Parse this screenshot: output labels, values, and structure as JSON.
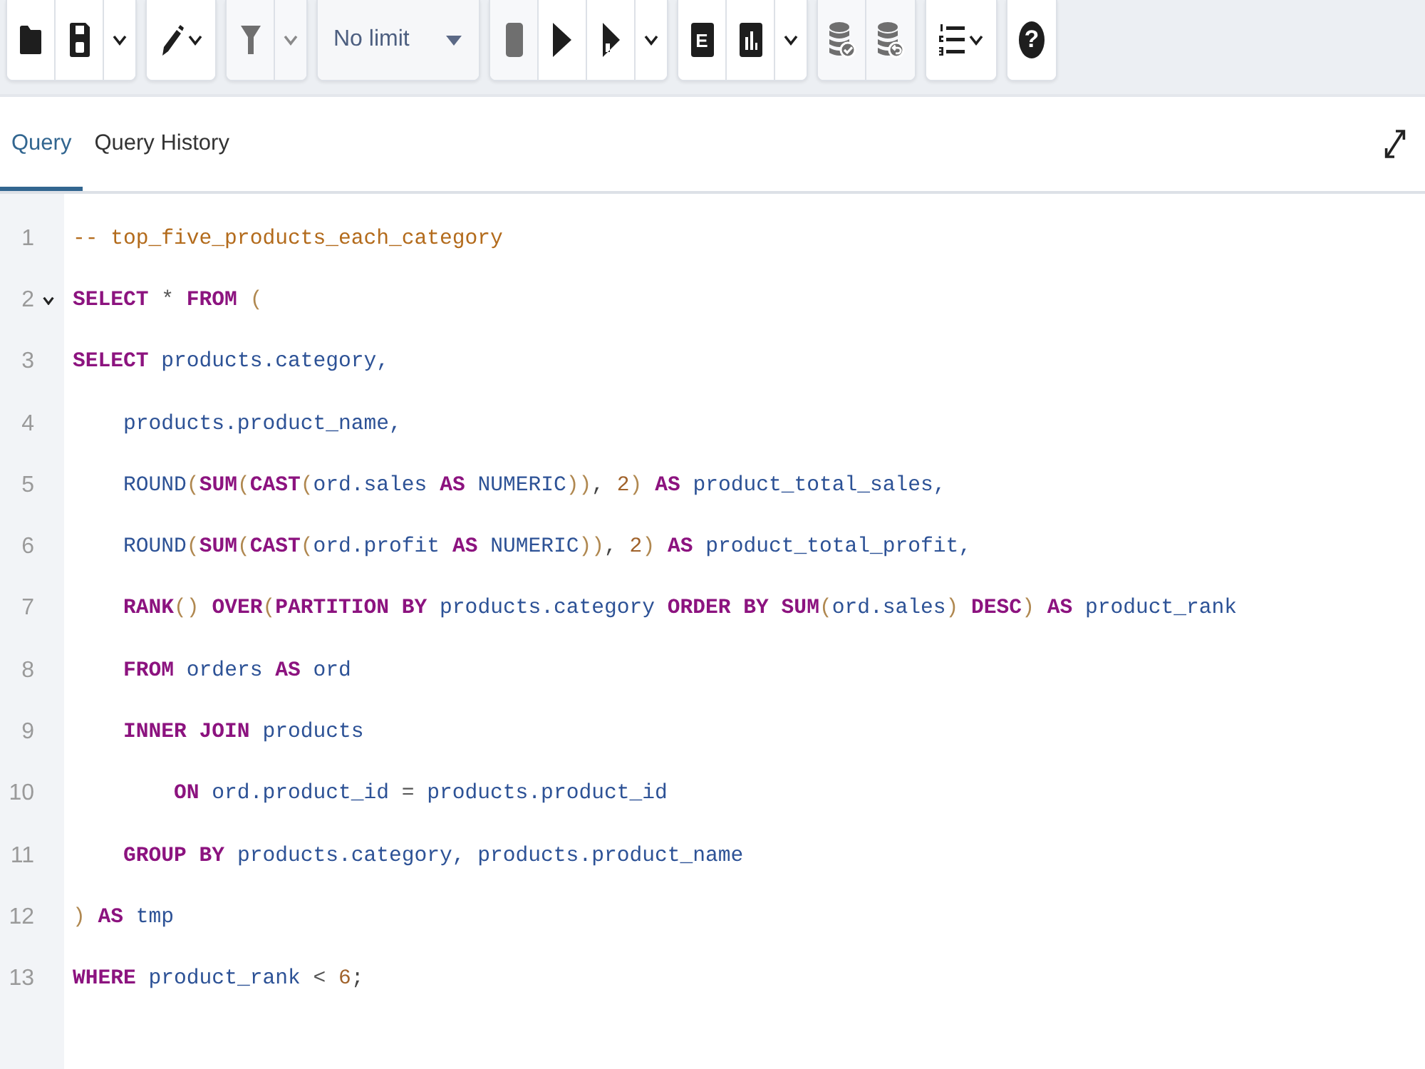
{
  "toolbar": {
    "groups": [
      {
        "buttons": [
          {
            "kind": "open",
            "disabled": false
          },
          {
            "kind": "save",
            "disabled": false
          },
          {
            "kind": "menu",
            "disabled": false
          }
        ]
      },
      {
        "buttons": [
          {
            "kind": "edit",
            "disabled": false
          }
        ]
      },
      {
        "buttons": [
          {
            "kind": "filter",
            "disabled": true
          },
          {
            "kind": "menu",
            "disabled": true
          }
        ]
      },
      {
        "buttons": [
          {
            "kind": "limit",
            "value": "No limit",
            "disabled": false
          }
        ]
      },
      {
        "buttons": [
          {
            "kind": "stop",
            "disabled": true
          },
          {
            "kind": "run",
            "disabled": false
          },
          {
            "kind": "script",
            "disabled": false
          },
          {
            "kind": "menu",
            "disabled": false
          }
        ]
      },
      {
        "buttons": [
          {
            "kind": "explain",
            "glyph": "E",
            "disabled": false
          },
          {
            "kind": "analyze",
            "disabled": false
          },
          {
            "kind": "menu",
            "disabled": false
          }
        ]
      },
      {
        "buttons": [
          {
            "kind": "commit",
            "disabled": true
          },
          {
            "kind": "rollback",
            "disabled": true
          }
        ]
      },
      {
        "buttons": [
          {
            "kind": "macros",
            "disabled": false
          }
        ]
      },
      {
        "buttons": [
          {
            "kind": "help",
            "glyph": "?",
            "disabled": false
          }
        ]
      }
    ]
  },
  "tabs": [
    {
      "label": "Query",
      "selected": true
    },
    {
      "label": "Query History",
      "selected": false
    }
  ],
  "editor": {
    "lines": [
      {
        "number": "1",
        "foldable": false,
        "tokens": [
          {
            "kind": "comment",
            "text": "-- top_five_products_each_category"
          }
        ]
      },
      {
        "number": "2",
        "foldable": true,
        "tokens": [
          {
            "kind": "keyword",
            "text": "SELECT"
          },
          {
            "kind": "operator",
            "text": " * "
          },
          {
            "kind": "keyword",
            "text": "FROM"
          },
          {
            "kind": "bracket",
            "text": " ("
          }
        ]
      },
      {
        "number": "3",
        "foldable": false,
        "tokens": [
          {
            "kind": "keyword",
            "text": "SELECT"
          },
          {
            "kind": "name",
            "text": " products.category,"
          }
        ],
        "children": [
          {
            "number": "4",
            "foldable": false,
            "tokens": [
              {
                "kind": "name",
                "text": "products.product_name,"
              }
            ]
          },
          {
            "number": "5",
            "foldable": false,
            "tokens": [
              {
                "kind": "name",
                "text": "ROUND"
              },
              {
                "kind": "bracket",
                "text": "("
              },
              {
                "kind": "keyword",
                "text": "SUM"
              },
              {
                "kind": "bracket",
                "text": "("
              },
              {
                "kind": "keyword",
                "text": "CAST"
              },
              {
                "kind": "bracket",
                "text": "("
              },
              {
                "kind": "name",
                "text": "ord.sales "
              },
              {
                "kind": "keyword",
                "text": "AS"
              },
              {
                "kind": "name",
                "text": " NUMERIC"
              },
              {
                "kind": "bracket",
                "text": "))"
              },
              {
                "kind": "punct",
                "text": ", "
              },
              {
                "kind": "number",
                "text": "2"
              },
              {
                "kind": "bracket",
                "text": ")"
              },
              {
                "kind": "keyword",
                "text": " AS"
              },
              {
                "kind": "name",
                "text": " product_total_sales,"
              }
            ]
          },
          {
            "number": "6",
            "foldable": false,
            "tokens": [
              {
                "kind": "name",
                "text": "ROUND"
              },
              {
                "kind": "bracket",
                "text": "("
              },
              {
                "kind": "keyword",
                "text": "SUM"
              },
              {
                "kind": "bracket",
                "text": "("
              },
              {
                "kind": "keyword",
                "text": "CAST"
              },
              {
                "kind": "bracket",
                "text": "("
              },
              {
                "kind": "name",
                "text": "ord.profit "
              },
              {
                "kind": "keyword",
                "text": "AS"
              },
              {
                "kind": "name",
                "text": " NUMERIC"
              },
              {
                "kind": "bracket",
                "text": "))"
              },
              {
                "kind": "punct",
                "text": ", "
              },
              {
                "kind": "number",
                "text": "2"
              },
              {
                "kind": "bracket",
                "text": ")"
              },
              {
                "kind": "keyword",
                "text": " AS"
              },
              {
                "kind": "name",
                "text": " product_total_profit,"
              }
            ]
          },
          {
            "number": "7",
            "foldable": false,
            "tokens": [
              {
                "kind": "keyword",
                "text": "RANK"
              },
              {
                "kind": "bracket",
                "text": "()"
              },
              {
                "kind": "keyword",
                "text": " OVER"
              },
              {
                "kind": "bracket",
                "text": "("
              },
              {
                "kind": "keyword",
                "text": "PARTITION BY"
              },
              {
                "kind": "name",
                "text": " products.category "
              },
              {
                "kind": "keyword",
                "text": "ORDER BY SUM"
              },
              {
                "kind": "bracket",
                "text": "("
              },
              {
                "kind": "name",
                "text": "ord.sales"
              },
              {
                "kind": "bracket",
                "text": ")"
              },
              {
                "kind": "keyword",
                "text": " DESC"
              },
              {
                "kind": "bracket",
                "text": ")"
              },
              {
                "kind": "keyword",
                "text": " AS"
              },
              {
                "kind": "name",
                "text": " product_rank"
              }
            ]
          },
          {
            "number": "8",
            "foldable": false,
            "tokens": [
              {
                "kind": "keyword",
                "text": "FROM"
              },
              {
                "kind": "name",
                "text": " orders "
              },
              {
                "kind": "keyword",
                "text": "AS"
              },
              {
                "kind": "name",
                "text": " ord"
              }
            ]
          },
          {
            "number": "9",
            "foldable": false,
            "tokens": [
              {
                "kind": "keyword",
                "text": "INNER JOIN"
              },
              {
                "kind": "name",
                "text": " products"
              }
            ],
            "children": [
              {
                "number": "10",
                "foldable": false,
                "tokens": [
                  {
                    "kind": "keyword",
                    "text": "ON"
                  },
                  {
                    "kind": "name",
                    "text": " ord.product_id "
                  },
                  {
                    "kind": "operator",
                    "text": "="
                  },
                  {
                    "kind": "name",
                    "text": " products.product_id"
                  }
                ]
              }
            ]
          },
          {
            "number": "11",
            "foldable": false,
            "tokens": [
              {
                "kind": "keyword",
                "text": "GROUP BY"
              },
              {
                "kind": "name",
                "text": " products.category, products.product_name"
              }
            ]
          }
        ]
      },
      {
        "number": "12",
        "foldable": false,
        "tokens": [
          {
            "kind": "bracket",
            "text": ")"
          },
          {
            "kind": "keyword",
            "text": " AS"
          },
          {
            "kind": "name",
            "text": " tmp"
          }
        ]
      },
      {
        "number": "13",
        "foldable": false,
        "tokens": [
          {
            "kind": "keyword",
            "text": "WHERE"
          },
          {
            "kind": "name",
            "text": " product_rank "
          },
          {
            "kind": "operator",
            "text": "<"
          },
          {
            "kind": "number",
            "text": " 6"
          },
          {
            "kind": "punct",
            "text": ";"
          }
        ]
      }
    ]
  }
}
